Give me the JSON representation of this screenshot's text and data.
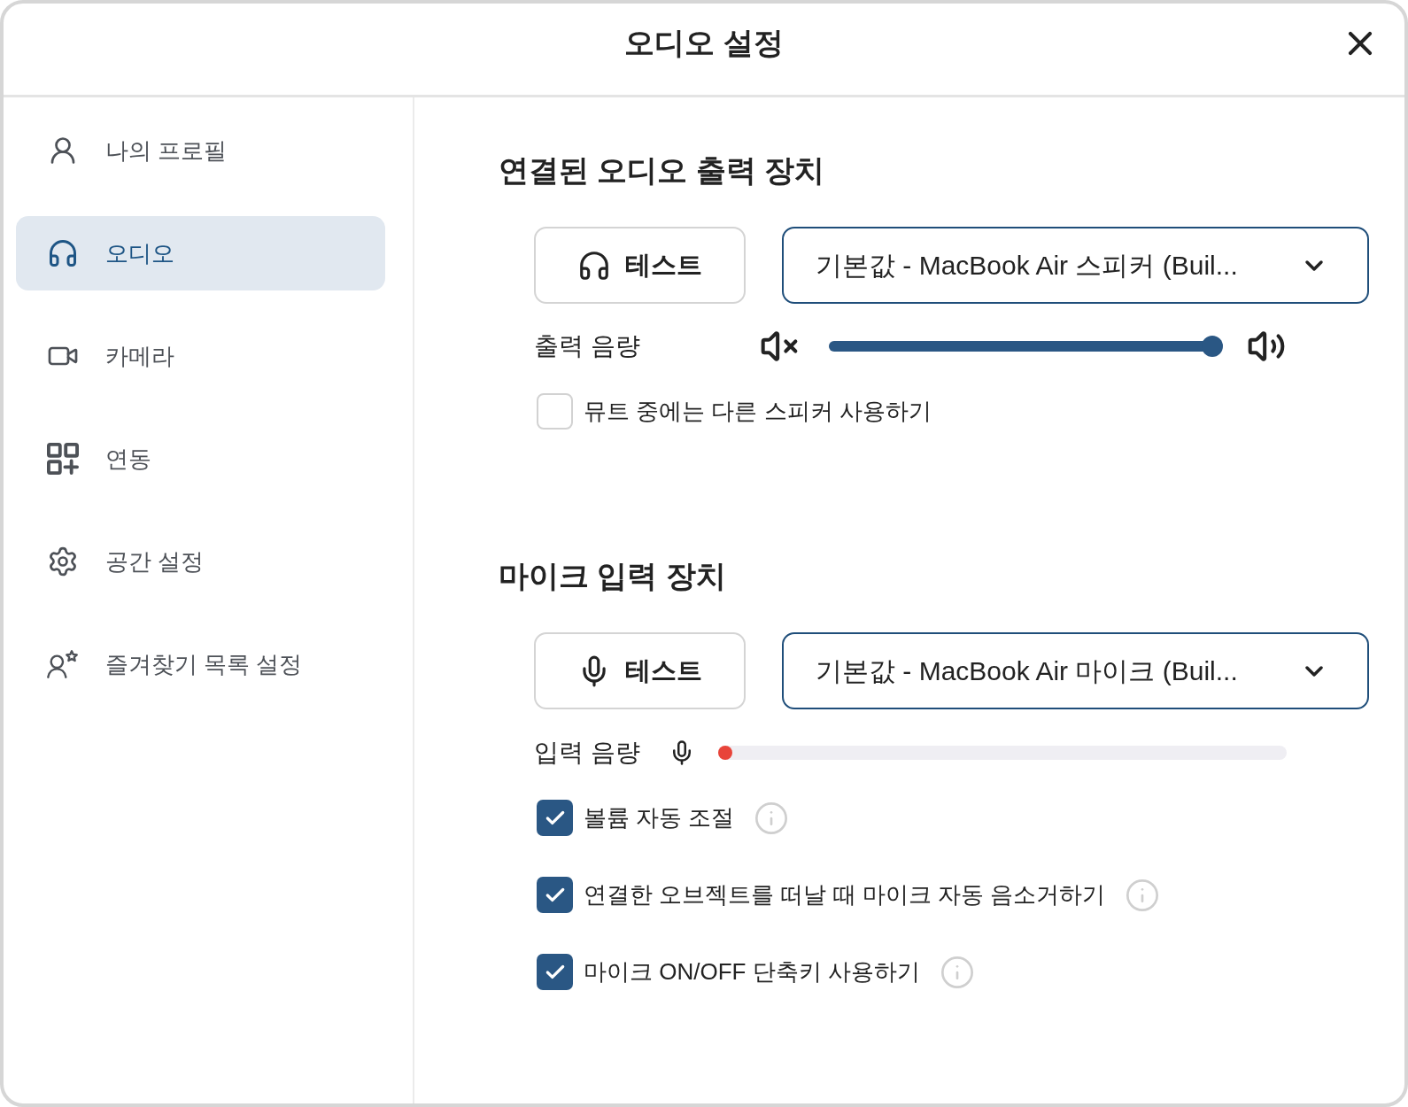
{
  "window": {
    "title": "오디오 설정"
  },
  "sidebar": {
    "items": [
      {
        "label": "나의 프로필",
        "selected": false
      },
      {
        "label": "오디오",
        "selected": true
      },
      {
        "label": "카메라",
        "selected": false
      },
      {
        "label": "연동",
        "selected": false
      },
      {
        "label": "공간 설정",
        "selected": false
      },
      {
        "label": "즐겨찾기 목록 설정",
        "selected": false
      }
    ]
  },
  "output_device": {
    "title": "연결된 오디오 출력 장치",
    "test_button": "테스트",
    "device_select": {
      "value": "기본값 - MacBook Air 스피커 (Buil..."
    },
    "volume": {
      "label": "출력 음량",
      "level": 1
    },
    "options": [
      {
        "label": "뮤트 중에는 다른 스피커 사용하기",
        "checked": false,
        "info": false
      }
    ]
  },
  "input_device": {
    "title": "마이크 입력 장치",
    "test_button": "테스트",
    "device_select": {
      "value": "기본값 - MacBook Air 마이크 (Buil..."
    },
    "volume": {
      "label": "입력 음량",
      "level": 0
    },
    "options": [
      {
        "label": "볼륨 자동 조절",
        "checked": true,
        "info": true
      },
      {
        "label": "연결한 오브젝트를 떠날 때 마이크 자동 음소거하기",
        "checked": true,
        "info": true
      },
      {
        "label": "마이크 ON/OFF 단축키 사용하기",
        "checked": true,
        "info": true
      }
    ]
  }
}
